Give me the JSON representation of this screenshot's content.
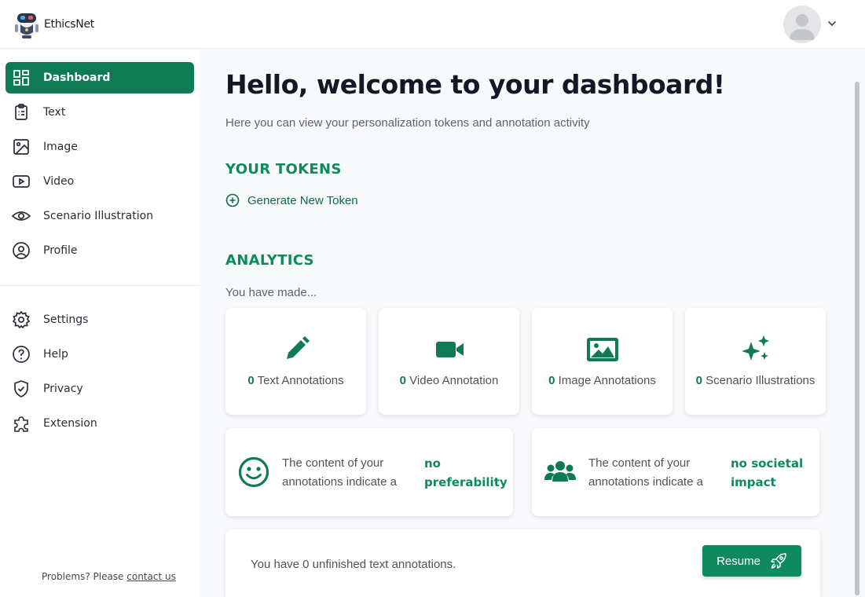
{
  "app": {
    "name": "EthicsNet"
  },
  "sidebar": {
    "primary": [
      {
        "label": "Dashboard",
        "icon": "dashboard-icon",
        "active": true
      },
      {
        "label": "Text",
        "icon": "clipboard-list-icon"
      },
      {
        "label": "Image",
        "icon": "image-icon"
      },
      {
        "label": "Video",
        "icon": "video-play-icon"
      },
      {
        "label": "Scenario Illustration",
        "icon": "eye-icon"
      },
      {
        "label": "Profile",
        "icon": "user-circle-icon"
      }
    ],
    "secondary": [
      {
        "label": "Settings",
        "icon": "gear-icon"
      },
      {
        "label": "Help",
        "icon": "help-circle-icon"
      },
      {
        "label": "Privacy",
        "icon": "shield-check-icon"
      },
      {
        "label": "Extension",
        "icon": "puzzle-icon"
      }
    ],
    "footer": {
      "text": "Problems? Please",
      "link": "contact us"
    }
  },
  "main": {
    "title": "Hello, welcome to your dashboard!",
    "subtitle": "Here you can view your personalization tokens and annotation activity",
    "tokens": {
      "heading": "YOUR TOKENS",
      "generate_label": "Generate New Token"
    },
    "analytics": {
      "heading": "ANALYTICS",
      "intro": "You have made...",
      "stats": [
        {
          "count": "0",
          "label": "Text Annotations",
          "icon": "pencil-icon"
        },
        {
          "count": "0",
          "label": "Video Annotation",
          "icon": "video-camera-icon"
        },
        {
          "count": "0",
          "label": "Image Annotations",
          "icon": "picture-icon"
        },
        {
          "count": "0",
          "label": "Scenario Illustrations",
          "icon": "sparkles-icon"
        }
      ],
      "impacts": [
        {
          "text": "The content of your annotations indicate a",
          "value": "no preferability",
          "icon": "smiley-icon"
        },
        {
          "text": "The content of your annotations indicate a",
          "value": "no societal impact",
          "icon": "users-group-icon"
        }
      ]
    },
    "resume": {
      "text": "You have 0 unfinished text annotations.",
      "button": "Resume"
    }
  },
  "colors": {
    "accent": "#0f7b55",
    "accent_text": "#0f8a5f"
  }
}
